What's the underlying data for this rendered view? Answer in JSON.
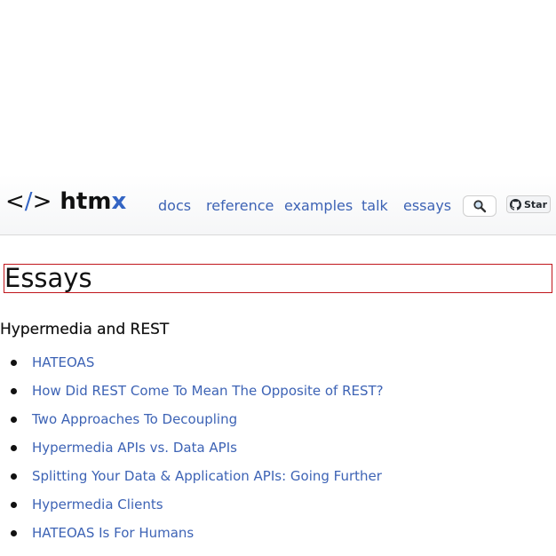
{
  "header": {
    "logo": {
      "lt": "<",
      "slash": "/",
      "gt": ">",
      "brand": "htm",
      "brand_x": "x"
    },
    "nav": [
      {
        "label": "docs"
      },
      {
        "label": "reference"
      },
      {
        "label": "examples"
      },
      {
        "label": "talk"
      },
      {
        "label": "essays"
      }
    ],
    "search_icon": "magnifier-icon",
    "github": {
      "icon": "github-icon",
      "label": "Star"
    }
  },
  "page": {
    "title": "Essays",
    "sections": [
      {
        "heading": "Hypermedia and REST",
        "items": [
          {
            "label": "HATEOAS"
          },
          {
            "label": "How Did REST Come To Mean The Opposite of REST?"
          },
          {
            "label": "Two Approaches To Decoupling"
          },
          {
            "label": "Hypermedia APIs vs. Data APIs"
          },
          {
            "label": "Splitting Your Data & Application APIs: Going Further"
          },
          {
            "label": "Hypermedia Clients"
          },
          {
            "label": "HATEOAS Is For Humans"
          }
        ]
      }
    ]
  },
  "colors": {
    "link": "#3d63b5",
    "logo_accent": "#3465c4",
    "highlight_border": "#c0161c"
  }
}
